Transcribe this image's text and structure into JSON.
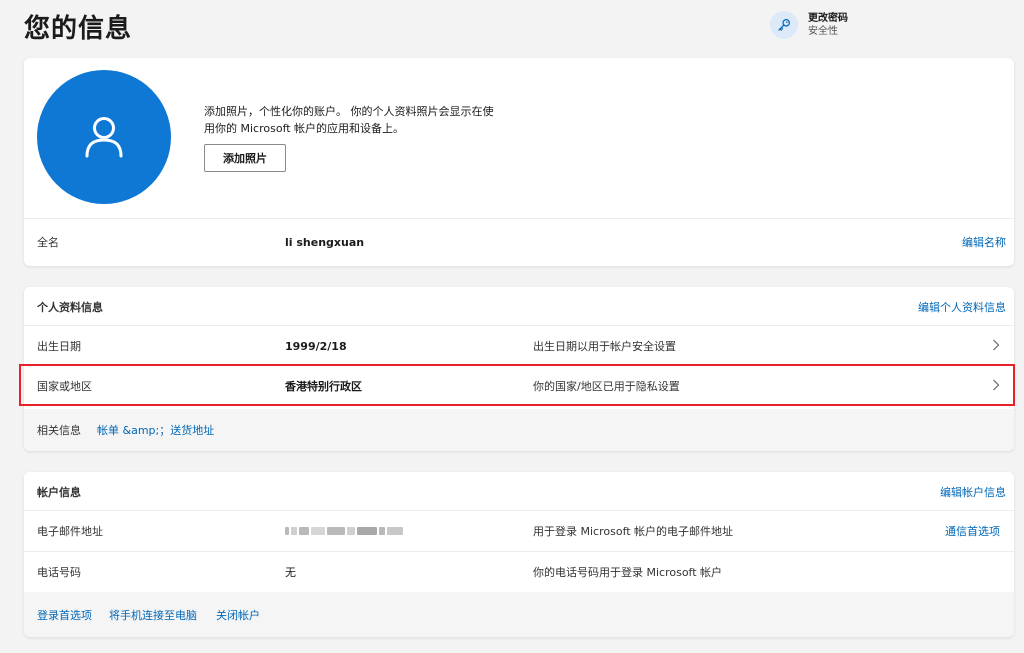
{
  "page": {
    "title": "您的信息"
  },
  "password": {
    "title": "更改密码",
    "subtitle": "安全性",
    "icon": "key-icon"
  },
  "profile_card": {
    "avatar_icon": "person-icon",
    "photo_desc_line1": "添加照片，个性化你的账户。 你的个人资料照片会显示在使",
    "photo_desc_line2": "用你的 Microsoft 帐户的应用和设备上。",
    "add_photo_label": "添加照片",
    "fullname_label": "全名",
    "fullname_value": "li shengxuan",
    "edit_name_label": "编辑名称"
  },
  "personal_info": {
    "title": "个人资料信息",
    "edit_label": "编辑个人资料信息",
    "rows": [
      {
        "label": "出生日期",
        "value": "1999/2/18",
        "desc": "出生日期以用于帐户安全设置"
      },
      {
        "label": "国家或地区",
        "value": "香港特别行政区",
        "desc": "你的国家/地区已用于隐私设置"
      }
    ],
    "related_label": "相关信息",
    "related_link": "帐单 &amp;；送货地址"
  },
  "account_info": {
    "title": "帐户信息",
    "edit_label": "编辑帐户信息",
    "email_label": "电子邮件地址",
    "email_desc": "用于登录 Microsoft 帐户的电子邮件地址",
    "email_link": "通信首选项",
    "phone_label": "电话号码",
    "phone_value": "无",
    "phone_desc": "你的电话号码用于登录 Microsoft 帐户",
    "footer_links": [
      "登录首选项",
      "将手机连接至电脑",
      "关闭帐户"
    ]
  },
  "colors": {
    "accent": "#0067b8",
    "avatar": "#0f78d4",
    "highlight": "#e8202a"
  }
}
